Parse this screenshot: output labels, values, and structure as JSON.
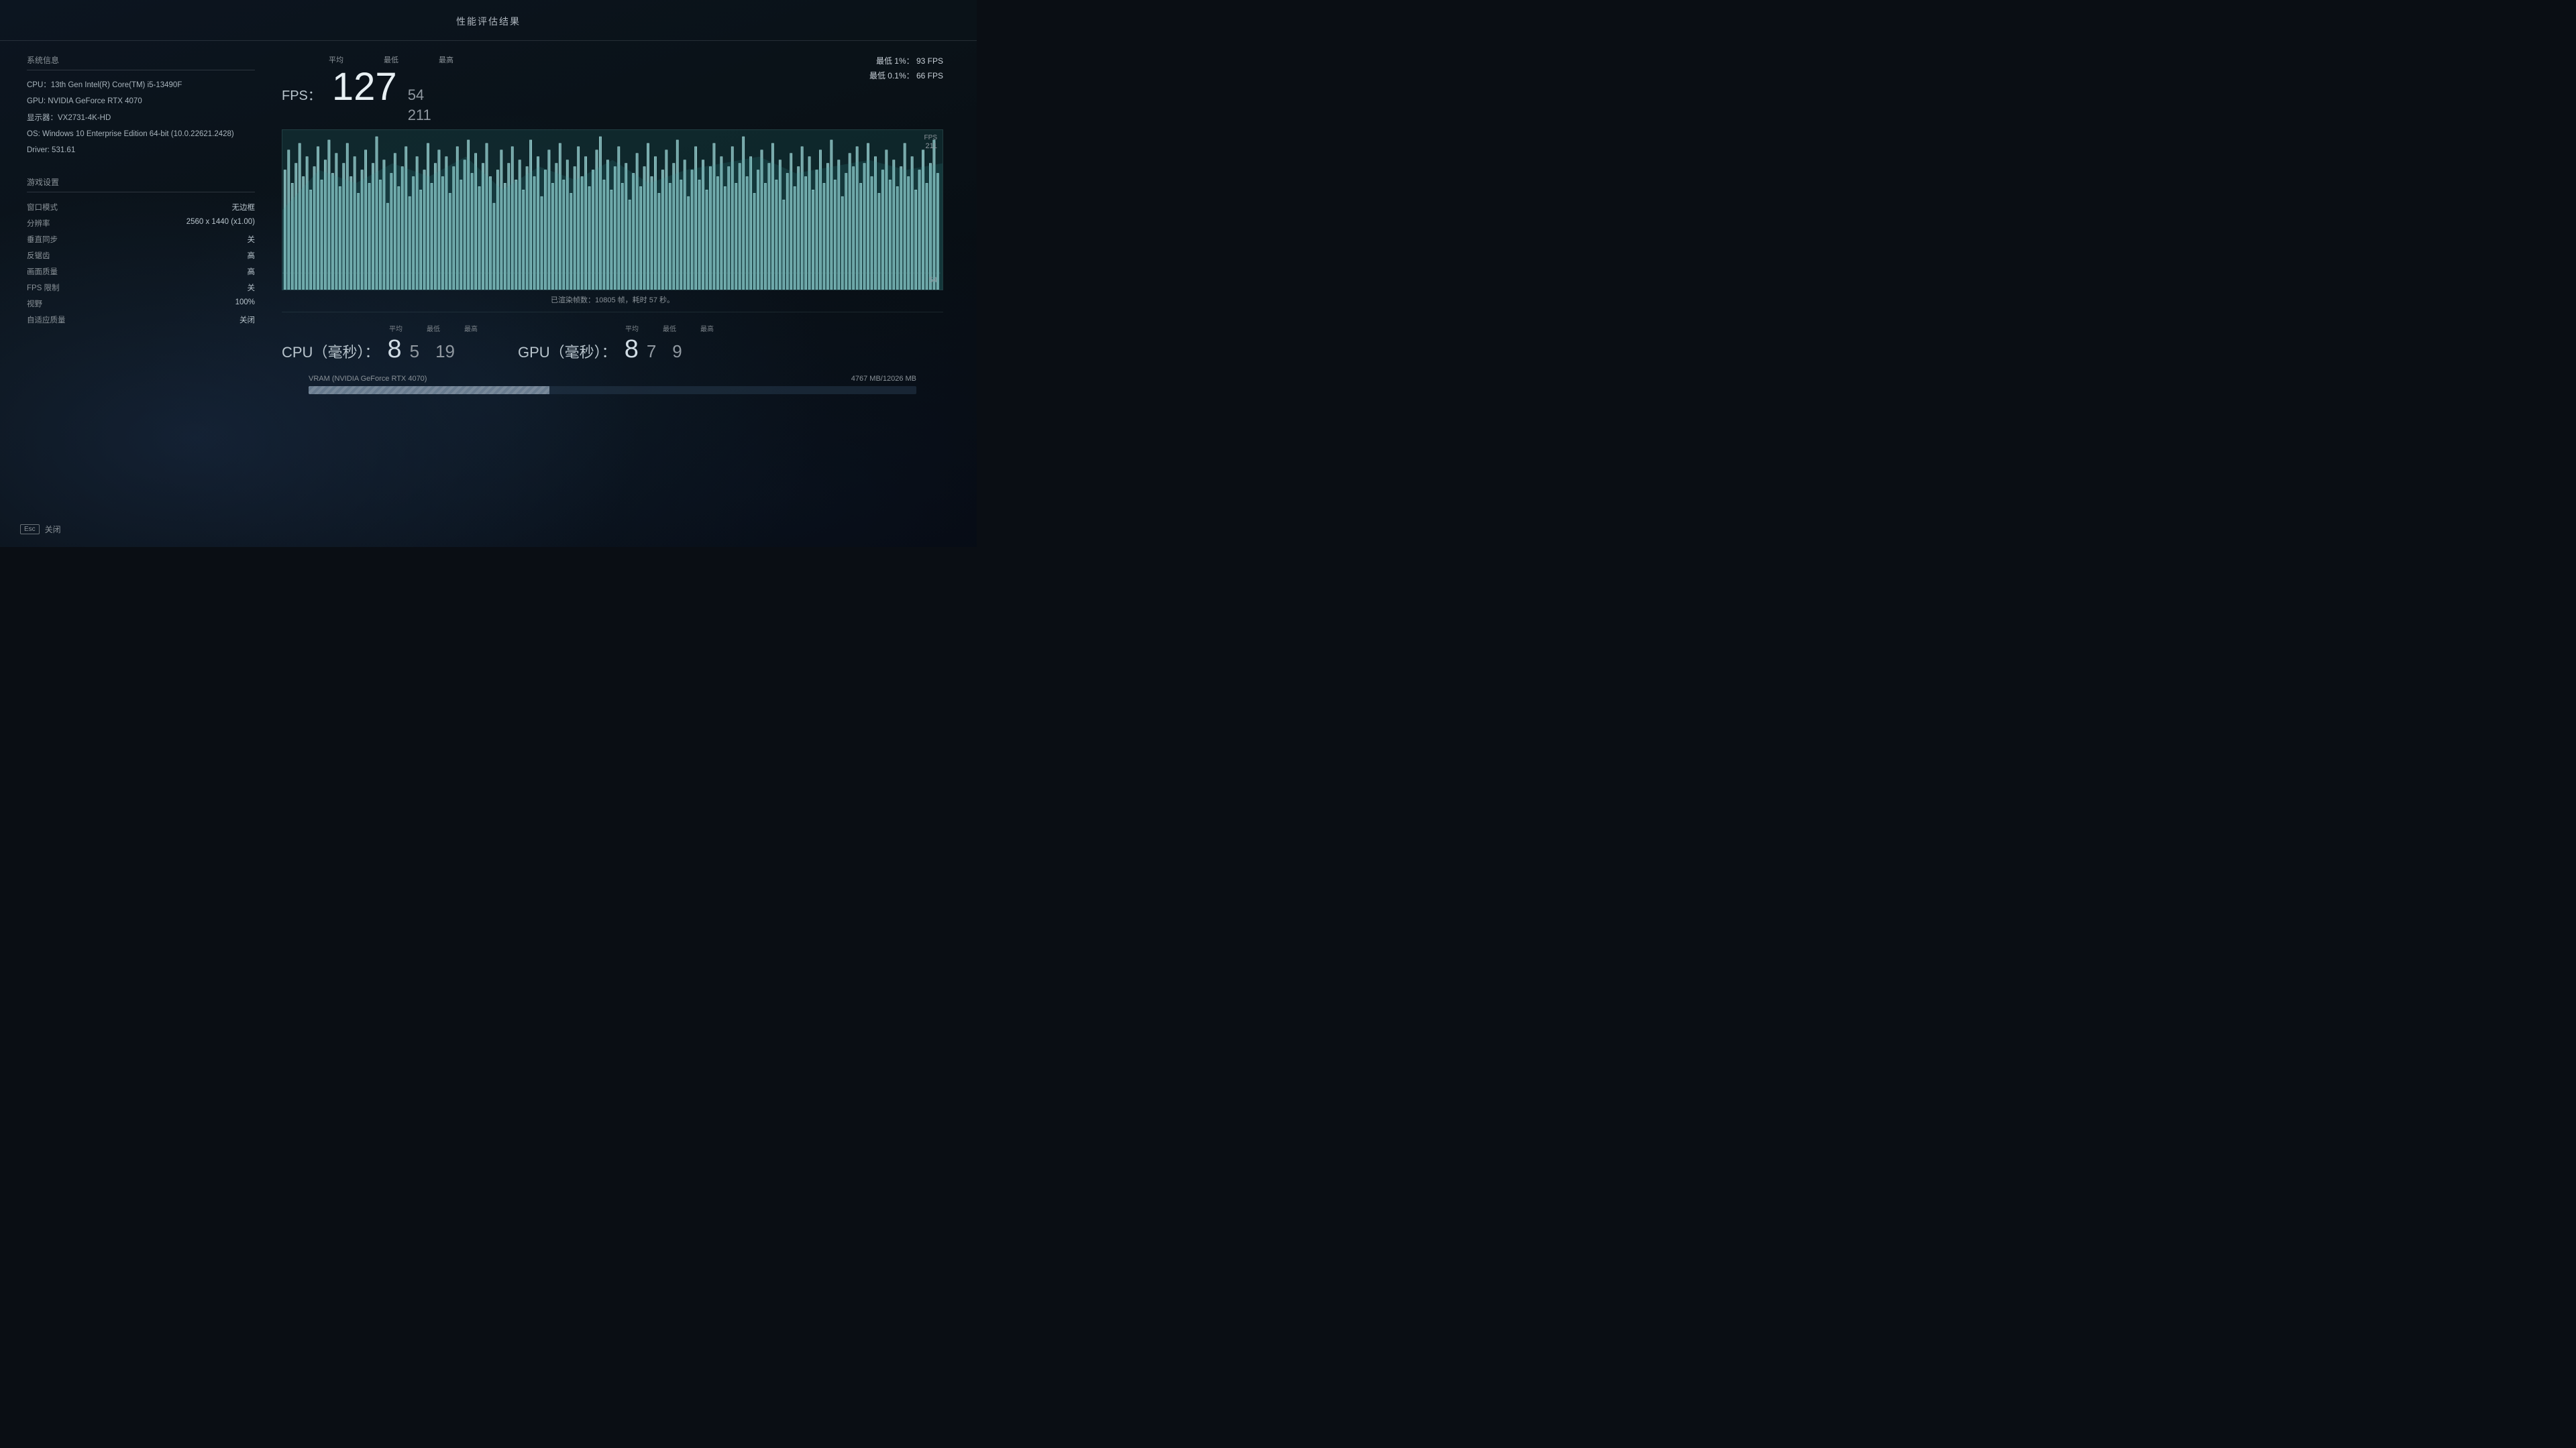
{
  "header": {
    "title": "性能评估结果"
  },
  "system_info": {
    "section_title": "系统信息",
    "cpu": "CPU：13th Gen Intel(R) Core(TM) i5-13490F",
    "gpu": "GPU: NVIDIA GeForce RTX 4070",
    "display": "显示器：VX2731-4K-HD",
    "os": "OS: Windows 10 Enterprise Edition 64-bit (10.0.22621.2428)",
    "driver": "Driver: 531.61"
  },
  "game_settings": {
    "section_title": "游戏设置",
    "rows": [
      {
        "key": "窗口模式",
        "value": "无边框"
      },
      {
        "key": "分辨率",
        "value": "2560 x 1440 (x1.00)"
      },
      {
        "key": "垂直同步",
        "value": "关"
      },
      {
        "key": "反锯齿",
        "value": "高"
      },
      {
        "key": "画面质量",
        "value": "高"
      },
      {
        "key": "FPS 限制",
        "value": "关"
      },
      {
        "key": "视野",
        "value": "100%"
      },
      {
        "key": "自适应质量",
        "value": "关闭"
      }
    ]
  },
  "fps_stats": {
    "col_avg": "平均",
    "col_min": "最低",
    "col_max": "最高",
    "fps_label": "FPS：",
    "fps_avg": "127",
    "fps_min": "54",
    "fps_max": "211",
    "fps_max_value": "211",
    "fps_min_value": "54",
    "fps_chart_label": "FPS",
    "percentile_1": "最低 1%：",
    "percentile_1_value": "93 FPS",
    "percentile_01": "最低 0.1%：",
    "percentile_01_value": "66 FPS"
  },
  "chart": {
    "caption": "已渲染帧数：10805 帧，耗时 57 秒。"
  },
  "cpu_stats": {
    "label": "CPU（毫秒）：",
    "col_avg": "平均",
    "col_min": "最低",
    "col_max": "最高",
    "avg": "8",
    "min": "5",
    "max": "19"
  },
  "gpu_stats": {
    "label": "GPU（毫秒）：",
    "col_avg": "平均",
    "col_min": "最低",
    "col_max": "最高",
    "avg": "8",
    "min": "7",
    "max": "9"
  },
  "vram": {
    "label": "VRAM (NVIDIA GeForce RTX 4070)",
    "used": "4767 MB/12026 MB",
    "fill_percent": 39.6
  },
  "footer": {
    "esc_label": "Esc",
    "close_label": "关闭"
  }
}
